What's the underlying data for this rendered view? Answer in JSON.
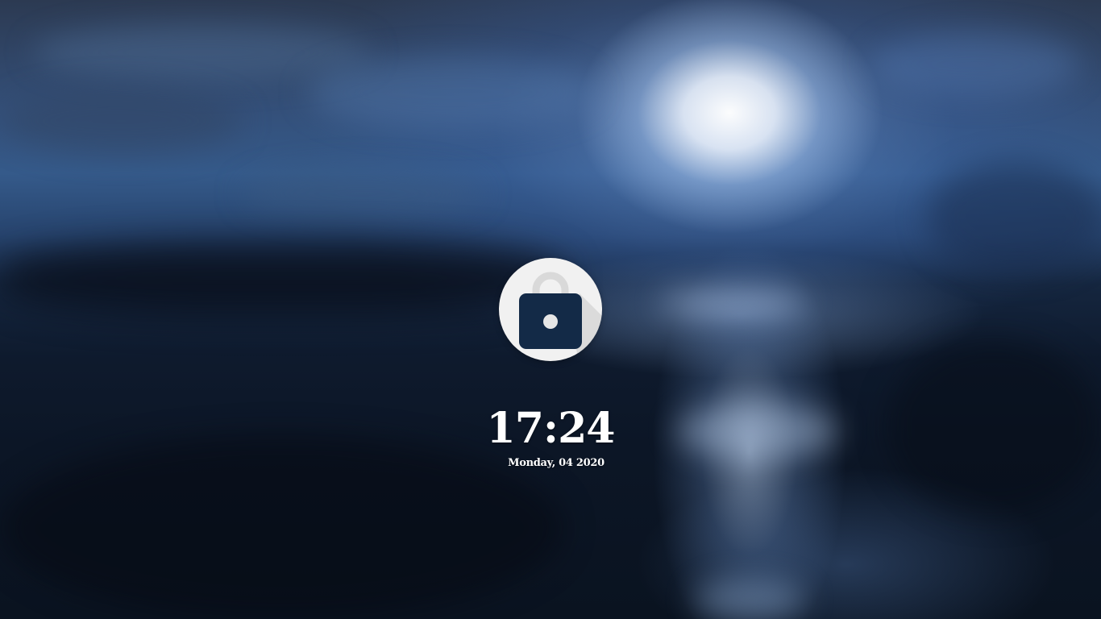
{
  "lockscreen": {
    "icon": "lock-icon",
    "time": "17:24",
    "date": "Monday, 04 2020"
  },
  "colors": {
    "icon_background": "#f1f1f1",
    "padlock_body": "#132a47",
    "padlock_shackle": "#d9d9d9",
    "text": "#ffffff"
  }
}
